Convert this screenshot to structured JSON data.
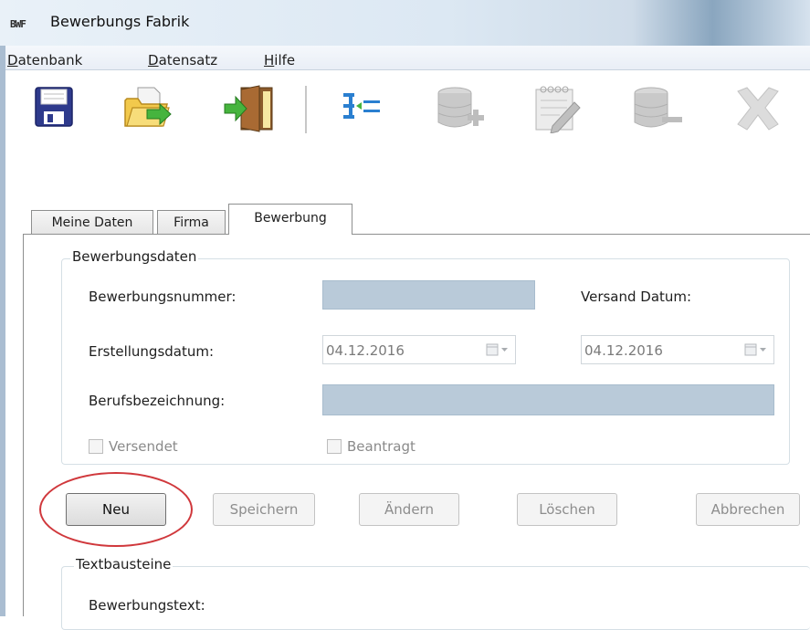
{
  "window": {
    "logo": "BWF",
    "title": "Bewerbungs Fabrik"
  },
  "menu": {
    "items": [
      {
        "underline": "D",
        "rest": "atenbank"
      },
      {
        "underline": "D",
        "rest": "atensatz"
      },
      {
        "underline": "H",
        "rest": "ilfe"
      }
    ]
  },
  "toolbar": {
    "icons": [
      "save-icon",
      "open-folder-icon",
      "exit-door-icon",
      "indent-icon",
      "database-add-icon",
      "notepad-edit-icon",
      "database-remove-icon",
      "delete-icon"
    ]
  },
  "tabs": [
    "Meine Daten",
    "Firma",
    "Bewerbung"
  ],
  "active_tab": "Bewerbung",
  "bewerbungsdaten": {
    "title": "Bewerbungsdaten",
    "bewerbungsnummer_label": "Bewerbungsnummer:",
    "bewerbungsnummer_value": "",
    "versand_label": "Versand Datum:",
    "erstellungsdatum_label": "Erstellungsdatum:",
    "erstellungsdatum_value": "04.12.2016",
    "versand_value": "04.12.2016",
    "berufsbezeichnung_label": "Berufsbezeichnung:",
    "berufsbezeichnung_value": "",
    "versendet_label": "Versendet",
    "beantragt_label": "Beantragt"
  },
  "buttons": {
    "neu": "Neu",
    "speichern": "Speichern",
    "aendern": "Ändern",
    "loeschen": "Löschen",
    "abbrechen": "Abbrechen"
  },
  "textbausteine": {
    "title": "Textbausteine",
    "bewerbungstext_label": "Bewerbungstext:"
  },
  "colors": {
    "highlight": "#d0383c",
    "field_fill": "#b9cad9"
  }
}
